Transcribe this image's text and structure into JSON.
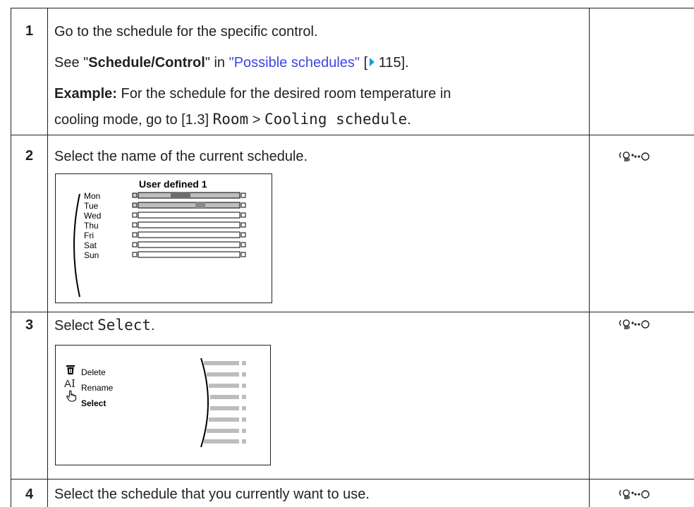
{
  "steps": [
    {
      "number": "1",
      "line1": "Go to the schedule for the specific control.",
      "line2_prefix": "See \"",
      "line2_bold": "Schedule/Control",
      "line2_mid": "\" in ",
      "line2_link": "\"Possible schedules\"",
      "line2_ref_open": " [",
      "line2_page": " 115",
      "line2_end": "].",
      "example_label": "Example:",
      "example_text": " For the schedule for the desired room temperature in",
      "line4_prefix": "cooling mode, go to [1.3] ",
      "line4_code1": "Room",
      "line4_sep": " > ",
      "line4_code2": "Cooling schedule",
      "line4_end": "."
    },
    {
      "number": "2",
      "text": "Select the name of the current schedule.",
      "screen": {
        "title": "User defined 1",
        "days": [
          "Mon",
          "Tue",
          "Wed",
          "Thu",
          "Fri",
          "Sat",
          "Sun"
        ]
      }
    },
    {
      "number": "3",
      "text_prefix": "Select ",
      "text_code": "Select",
      "text_end": ".",
      "screen": {
        "menu": [
          {
            "label": "Delete",
            "icon": "trash-icon"
          },
          {
            "label": "Rename",
            "icon": "text-cursor-icon"
          },
          {
            "label": "Select",
            "icon": "hand-pointer-icon"
          }
        ]
      }
    },
    {
      "number": "4",
      "text": "Select the schedule that you currently want to use."
    }
  ],
  "icons": {
    "action": "turn-dial-icon",
    "link_arrow": "play-arrow-icon"
  },
  "colors": {
    "link": "#3d46e4",
    "arrow": "#1a9ad6",
    "bar_fill": "#bdbdbd",
    "bar_dark": "#6e6e6e"
  }
}
